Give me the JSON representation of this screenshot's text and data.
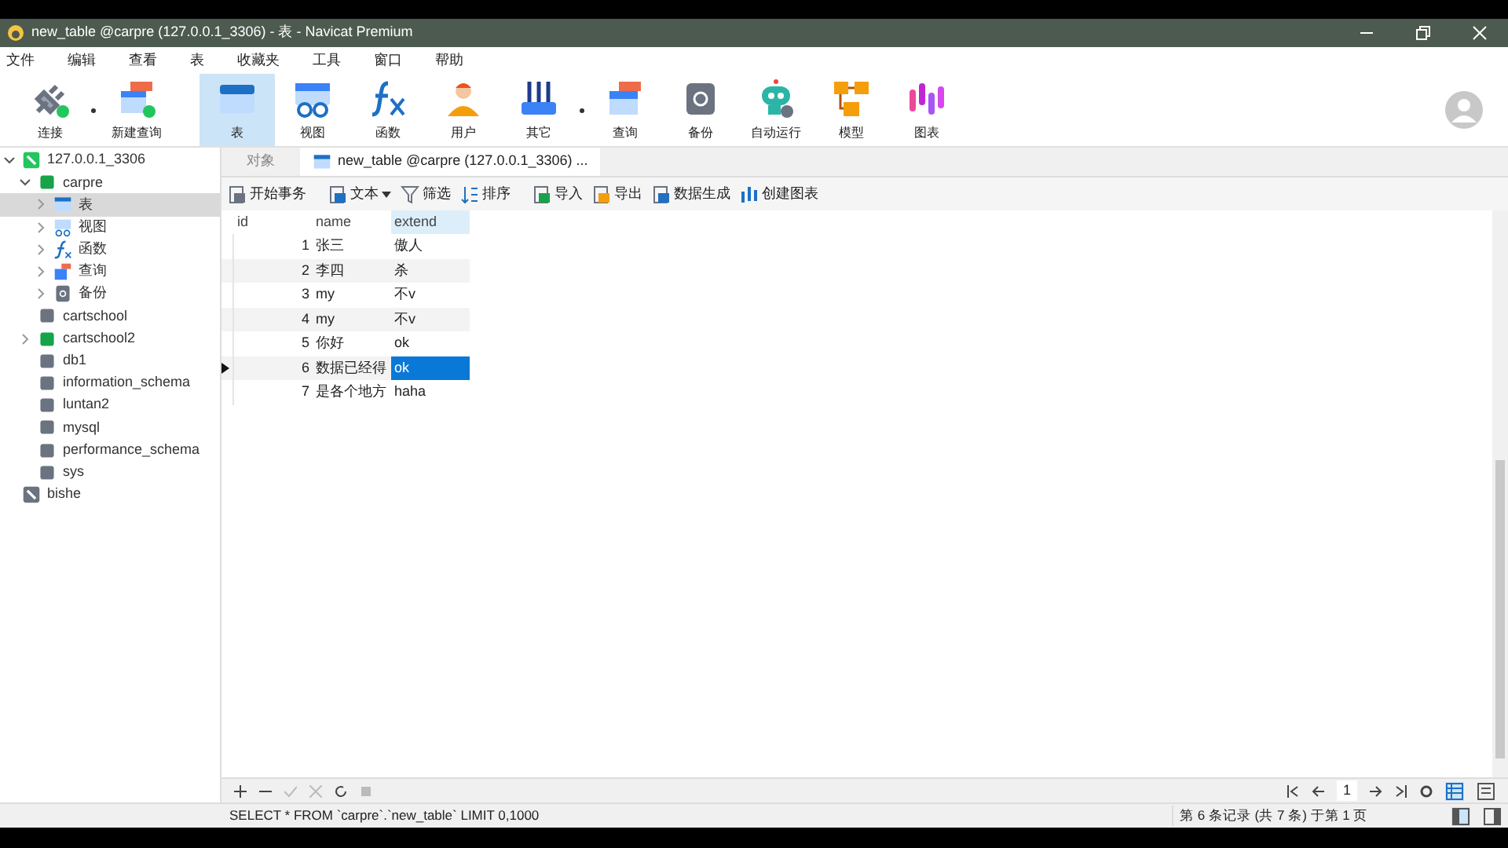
{
  "window": {
    "title": "new_table @carpre (127.0.0.1_3306) - 表 - Navicat Premium"
  },
  "menu": [
    "文件",
    "编辑",
    "查看",
    "表",
    "收藏夹",
    "工具",
    "窗口",
    "帮助"
  ],
  "toolbar": [
    {
      "kind": "plug",
      "label": "连接",
      "selected": false,
      "dropdown": true
    },
    {
      "kind": "newquery",
      "label": "新建查询",
      "selected": false,
      "dropdown": false
    },
    {
      "kind": "table",
      "label": "表",
      "selected": true,
      "dropdown": false
    },
    {
      "kind": "view",
      "label": "视图",
      "selected": false,
      "dropdown": false
    },
    {
      "kind": "function",
      "label": "函数",
      "selected": false,
      "dropdown": false
    },
    {
      "kind": "user",
      "label": "用户",
      "selected": false,
      "dropdown": false
    },
    {
      "kind": "tools",
      "label": "其它",
      "selected": false,
      "dropdown": true
    },
    {
      "kind": "query",
      "label": "查询",
      "selected": false,
      "dropdown": false
    },
    {
      "kind": "backup",
      "label": "备份",
      "selected": false,
      "dropdown": false
    },
    {
      "kind": "robot",
      "label": "自动运行",
      "selected": false,
      "dropdown": false
    },
    {
      "kind": "model",
      "label": "模型",
      "selected": false,
      "dropdown": false
    },
    {
      "kind": "chart",
      "label": "图表",
      "selected": false,
      "dropdown": false
    }
  ],
  "sidebar": {
    "items": [
      {
        "kind": "connection",
        "label": "127.0.0.1_3306",
        "expanded": true,
        "selected": false,
        "children": [
          {
            "kind": "db-open",
            "label": "carpre",
            "expanded": true,
            "selected": false,
            "children": [
              {
                "kind": "table",
                "label": "表",
                "expanded": false,
                "selected": true
              },
              {
                "kind": "view",
                "label": "视图",
                "expanded": false,
                "selected": false
              },
              {
                "kind": "function",
                "label": "函数",
                "expanded": false,
                "selected": false
              },
              {
                "kind": "query",
                "label": "查询",
                "expanded": false,
                "selected": false
              },
              {
                "kind": "backup",
                "label": "备份",
                "expanded": false,
                "selected": false
              }
            ]
          },
          {
            "kind": "db",
            "label": "cartschool",
            "selected": false
          },
          {
            "kind": "db-open",
            "label": "cartschool2",
            "expanded": false,
            "selected": false
          },
          {
            "kind": "db",
            "label": "db1",
            "selected": false
          },
          {
            "kind": "db",
            "label": "information_schema",
            "selected": false
          },
          {
            "kind": "db",
            "label": "luntan2",
            "selected": false
          },
          {
            "kind": "db",
            "label": "mysql",
            "selected": false
          },
          {
            "kind": "db",
            "label": "performance_schema",
            "selected": false
          },
          {
            "kind": "db",
            "label": "sys",
            "selected": false
          }
        ]
      },
      {
        "kind": "connection-off",
        "label": "bishe",
        "selected": false
      }
    ]
  },
  "tabs": [
    {
      "kind": "plain",
      "label": "对象",
      "selected": false
    },
    {
      "kind": "table",
      "label": "new_table @carpre (127.0.0.1_3306) ...",
      "selected": true
    }
  ],
  "table_toolbar": [
    {
      "kind": "transaction",
      "label": "开始事务",
      "dropdown": false
    },
    {
      "kind": "text",
      "label": "文本",
      "dropdown": true
    },
    {
      "kind": "filter",
      "label": "筛选",
      "dropdown": false
    },
    {
      "kind": "sort",
      "label": "排序",
      "dropdown": false
    },
    {
      "kind": "import",
      "label": "导入",
      "dropdown": false
    },
    {
      "kind": "export",
      "label": "导出",
      "dropdown": false
    },
    {
      "kind": "generate",
      "label": "数据生成",
      "dropdown": false
    },
    {
      "kind": "chart",
      "label": "创建图表",
      "dropdown": false
    }
  ],
  "table": {
    "columns": [
      "id",
      "name",
      "extend"
    ],
    "rows": [
      {
        "current": false,
        "cells": [
          {
            "text": "1",
            "selected": false
          },
          {
            "text": "张三",
            "selected": false
          },
          {
            "text": "傲人",
            "selected": false
          }
        ]
      },
      {
        "current": false,
        "cells": [
          {
            "text": "2",
            "selected": false
          },
          {
            "text": "李四",
            "selected": false
          },
          {
            "text": "杀",
            "selected": false
          }
        ]
      },
      {
        "current": false,
        "cells": [
          {
            "text": "3",
            "selected": false
          },
          {
            "text": "my",
            "selected": false
          },
          {
            "text": "不v",
            "selected": false
          }
        ]
      },
      {
        "current": false,
        "cells": [
          {
            "text": "4",
            "selected": false
          },
          {
            "text": "my",
            "selected": false
          },
          {
            "text": "不v",
            "selected": false
          }
        ]
      },
      {
        "current": false,
        "cells": [
          {
            "text": "5",
            "selected": false
          },
          {
            "text": "你好",
            "selected": false
          },
          {
            "text": "ok",
            "selected": false
          }
        ]
      },
      {
        "current": true,
        "cells": [
          {
            "text": "6",
            "selected": false
          },
          {
            "text": "数据已经得",
            "selected": false
          },
          {
            "text": "ok",
            "selected": true
          }
        ]
      },
      {
        "current": false,
        "cells": [
          {
            "text": "7",
            "selected": false
          },
          {
            "text": "是各个地方",
            "selected": false
          },
          {
            "text": "haha",
            "selected": false
          }
        ]
      }
    ]
  },
  "pager": {
    "page": "1"
  },
  "status_bar": {
    "sql": "SELECT * FROM `carpre`.`new_table` LIMIT 0,1000",
    "record": "第 6 条记录 (共 7 条) 于第 1 页"
  }
}
